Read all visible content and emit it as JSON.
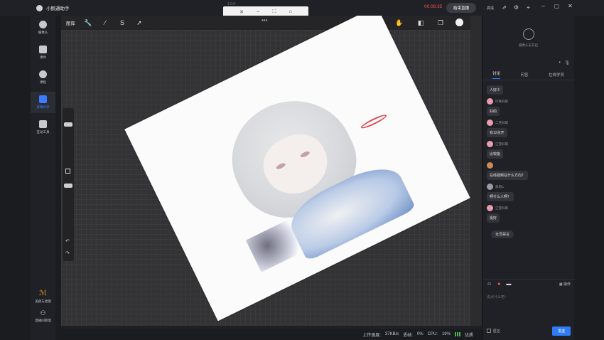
{
  "app": {
    "name": "小鹅通助手",
    "timer": "00:06:35",
    "end_live": "结束直播",
    "account": "高清"
  },
  "float_bar": {
    "title": "1 0:0",
    "icons": [
      "close-icon",
      "minimize-icon",
      "fullscreen-icon",
      "home-icon"
    ]
  },
  "leftnav": {
    "items": [
      {
        "label": "摄像头",
        "icon": "camera-icon"
      },
      {
        "label": "课件",
        "icon": "courseware-icon"
      },
      {
        "label": "课程",
        "icon": "palette-icon"
      },
      {
        "label": "屏幕共享",
        "icon": "screen-share-icon",
        "active": true
      },
      {
        "label": "互动工具",
        "icon": "toolbox-icon"
      }
    ],
    "bottom": [
      {
        "label": "美颜与滤镜"
      },
      {
        "label": "直播间管理"
      }
    ]
  },
  "procreate": {
    "gallery": "图库",
    "tools": [
      "wrench-icon",
      "magic-wand-icon",
      "s-icon",
      "arrow-icon"
    ],
    "right_tools": [
      "brush-icon",
      "smudge-icon",
      "eraser-icon",
      "layers-icon",
      "color-icon"
    ]
  },
  "status": {
    "upload_label": "上传速度:",
    "upload_value": "37KB/s",
    "loss_label": "丢帧:",
    "loss_value": "0%",
    "cpu_label": "CPU:",
    "cpu_value": "19%",
    "quality": "优质"
  },
  "rightpanel": {
    "camera_label": "摄像头未开启",
    "tabs": [
      "讨论",
      "问答",
      "在线学员"
    ],
    "messages": [
      {
        "who": "",
        "text": "人好少"
      },
      {
        "who": "叮咚抖耶",
        "text": "好的"
      },
      {
        "who": "二月抖耶",
        "text": "有12点开"
      },
      {
        "who": "江雪抖耶",
        "text": "比较能"
      },
      {
        "who": "",
        "text": "在线视频在什么方向？"
      },
      {
        "who": "斜塔C",
        "text": "啊什么人啊？"
      },
      {
        "who": "江雪抖耶",
        "text": "挺好"
      }
    ],
    "mute_all": "全员禁言",
    "more": "操作",
    "input_placeholder": "说点什么吧~",
    "anon_label": "匿名",
    "send": "发送"
  }
}
